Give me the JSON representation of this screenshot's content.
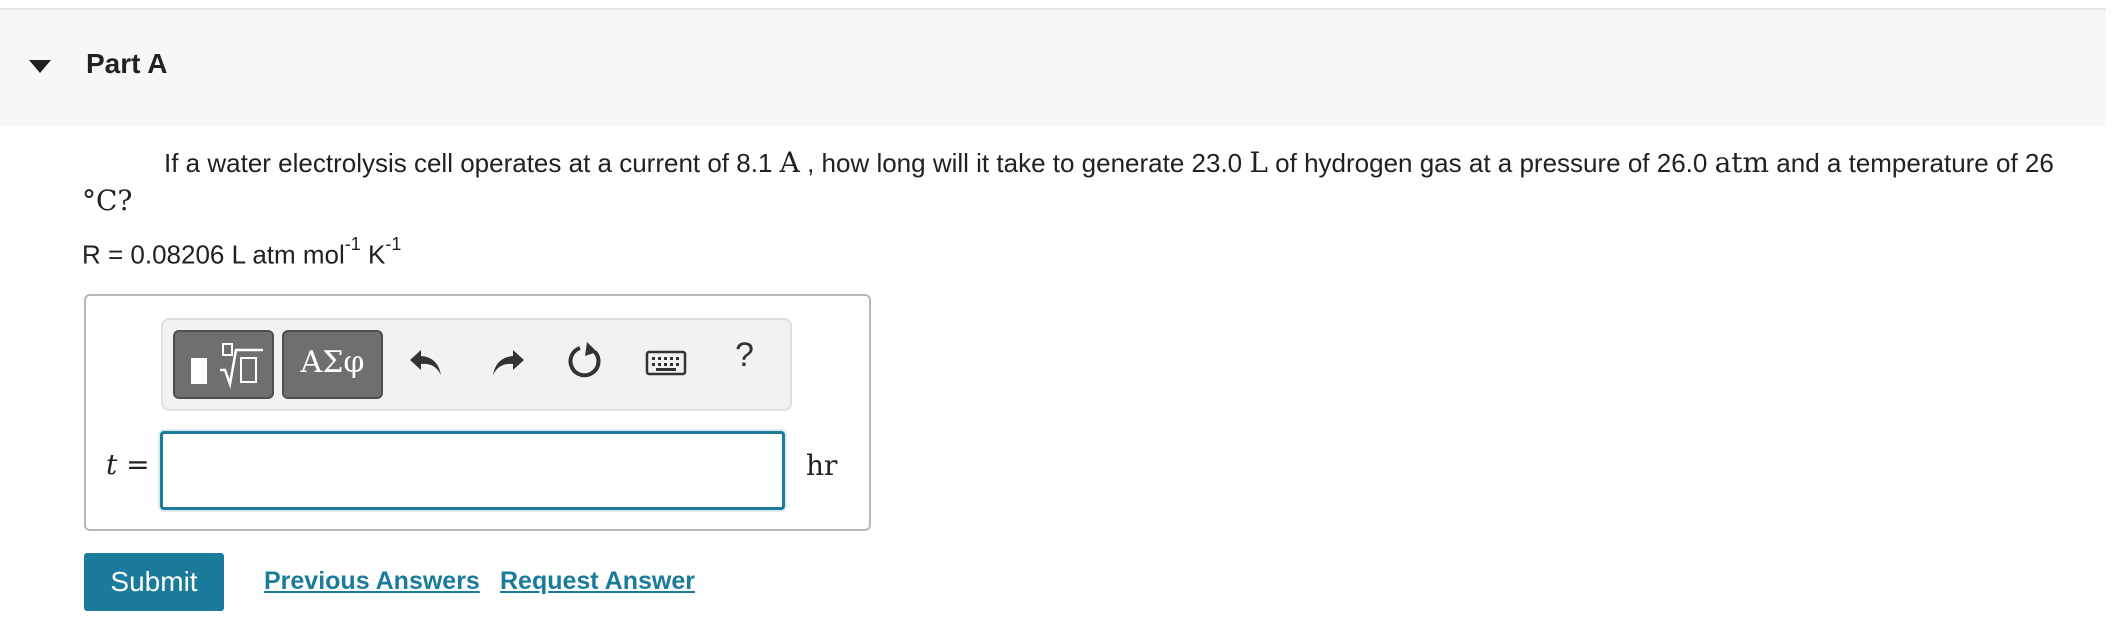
{
  "part": {
    "title": "Part A"
  },
  "question": {
    "text_1": "If a water electrolysis cell operates at a current of 8.1 ",
    "unit_current": "A",
    "text_2": " , how long will it take to generate 23.0 ",
    "unit_volume": "L",
    "text_3": " of hydrogen gas at a pressure of 26.0 ",
    "unit_pressure": "atm",
    "text_4": " and a temperature of 26 ",
    "unit_temperature": "°C?"
  },
  "constant": {
    "prefix": "R = 0.08206 L atm mol",
    "exp1": "-1",
    "mid": " K",
    "exp2": "-1"
  },
  "toolbar": {
    "greek_label": "ΑΣφ",
    "help_label": "?",
    "icons": [
      "templates-icon",
      "undo-icon",
      "redo-icon",
      "reset-icon",
      "keyboard-icon",
      "help-icon"
    ]
  },
  "answer": {
    "variable": "t",
    "equals": "=",
    "value": "",
    "unit": "hr"
  },
  "actions": {
    "submit_label": "Submit",
    "previous_answers_label": "Previous Answers",
    "request_answer_label": "Request Answer"
  },
  "colors": {
    "accent": "#1a7b9b",
    "header_bg": "#f7f7f7",
    "toolbar_dark": "#6f6f6f"
  }
}
